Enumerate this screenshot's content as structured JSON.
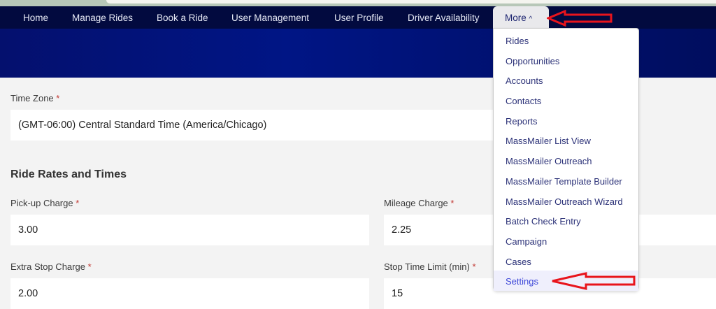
{
  "nav": {
    "items": [
      "Home",
      "Manage Rides",
      "Book a Ride",
      "User Management",
      "User Profile",
      "Driver Availability"
    ],
    "more_label": "More",
    "more_icon": "chevron-up-icon"
  },
  "dropdown": {
    "items": [
      "Rides",
      "Opportunities",
      "Accounts",
      "Contacts",
      "Reports",
      "MassMailer List View",
      "MassMailer Outreach",
      "MassMailer Template Builder",
      "MassMailer Outreach Wizard",
      "Batch Check Entry",
      "Campaign",
      "Cases",
      "Settings"
    ],
    "active": "Settings"
  },
  "form": {
    "time_zone": {
      "label": "Time Zone",
      "value": "(GMT-06:00) Central Standard Time (America/Chicago)"
    },
    "section_title": "Ride Rates and Times",
    "pickup": {
      "label": "Pick-up Charge",
      "value": "3.00"
    },
    "mileage": {
      "label": "Mileage Charge",
      "value": "2.25"
    },
    "extra_stop": {
      "label": "Extra Stop Charge",
      "value": "2.00"
    },
    "stop_time": {
      "label": "Stop Time Limit (min)",
      "value": "15"
    },
    "required_mark": "*"
  },
  "colors": {
    "nav": "#020a3f",
    "banner": "#001585",
    "annotation": "#e8141c"
  }
}
